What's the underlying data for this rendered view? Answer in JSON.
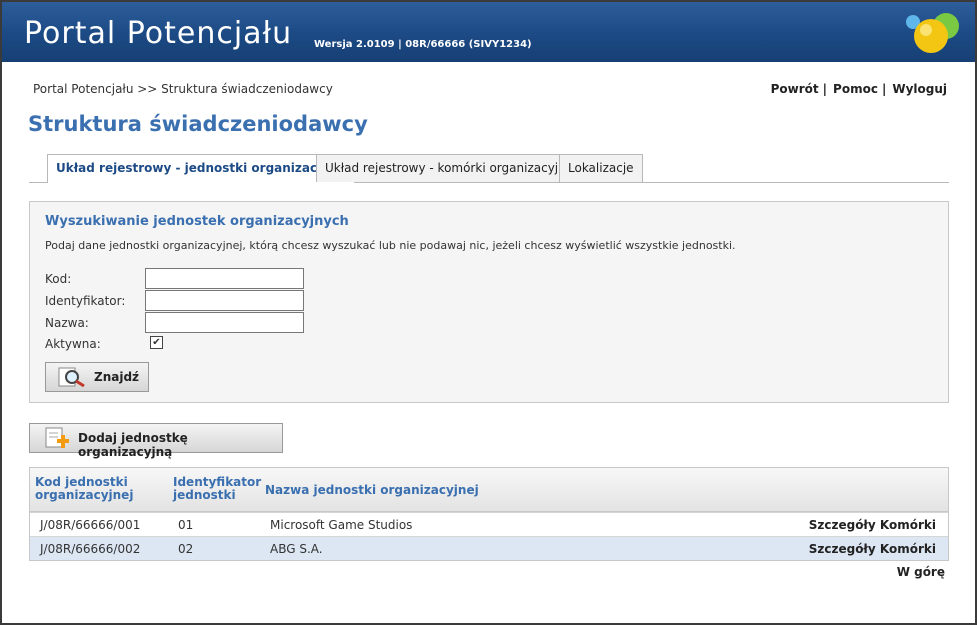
{
  "app": {
    "title": "Portal Potencjału",
    "version": "Wersja 2.0109 | 08R/66666 (SIVY1234)"
  },
  "breadcrumb": "Portal Potencjału >> Struktura świadczeniodawcy",
  "toplinks": {
    "back": "Powrót",
    "help": "Pomoc",
    "logout": "Wyloguj",
    "sep": "|"
  },
  "page_title": "Struktura świadczeniodawcy",
  "tabs": [
    {
      "label": "Układ rejestrowy - jednostki organizacyjne",
      "active": true
    },
    {
      "label": "Układ rejestrowy - komórki organizacyjne",
      "active": false
    },
    {
      "label": "Lokalizacje",
      "active": false
    }
  ],
  "search": {
    "heading": "Wyszukiwanie jednostek organizacyjnych",
    "description": "Podaj dane jednostki organizacyjnej, którą chcesz wyszukać lub nie podawaj nic, jeżeli chcesz wyświetlić wszystkie jednostki.",
    "fields": {
      "code": "Kod:",
      "identifier": "Identyfikator:",
      "name": "Nazwa:",
      "active": "Aktywna:"
    },
    "values": {
      "code": "",
      "identifier": "",
      "name": "",
      "active": true
    },
    "find_label": "Znajdź"
  },
  "add_button_label": "Dodaj jednostkę organizacyjną",
  "table": {
    "headers": {
      "code_line1": "Kod jednostki",
      "code_line2": "organizacyjnej",
      "id_line1": "Identyfikator",
      "id_line2": "jednostki",
      "name": "Nazwa jednostki organizacyjnej"
    },
    "rows": [
      {
        "code": "J/08R/66666/001",
        "id": "01",
        "name": "Microsoft Game Studios",
        "details": "Szczegóły",
        "cells": "Komórki"
      },
      {
        "code": "J/08R/66666/002",
        "id": "02",
        "name": "ABG S.A.",
        "details": "Szczegóły",
        "cells": "Komórki"
      }
    ]
  },
  "to_top": "W górę",
  "colors": {
    "header": "#1d4b86",
    "accent": "#3a6fb0",
    "row_alt": "#dde7f4"
  },
  "icons": {
    "find": "magnifier-icon",
    "add": "add-document-icon",
    "logo": "colored-balls-logo"
  }
}
